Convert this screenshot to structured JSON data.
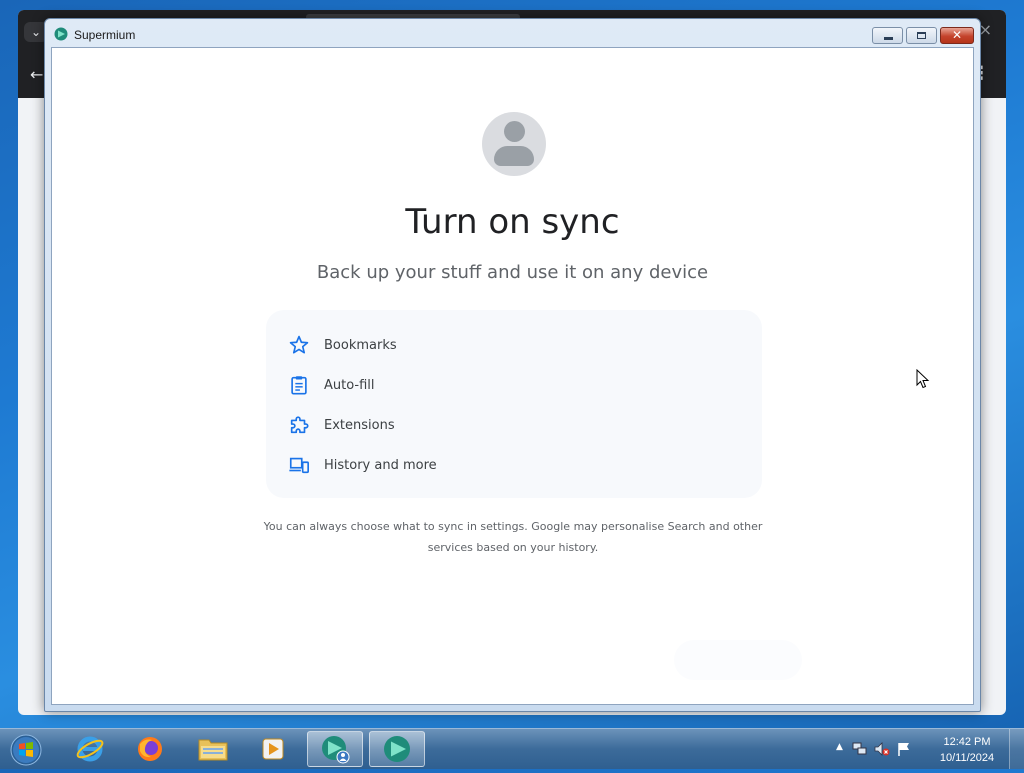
{
  "window": {
    "title": "Supermium",
    "controls": {
      "minimize": "minimize",
      "maximize": "maximize",
      "close": "close"
    }
  },
  "background_browser": {
    "close_glyph": "×",
    "back_glyph": "←",
    "menu_glyph": "⋮",
    "tab_chevron": "⌄"
  },
  "sync": {
    "heading": "Turn on sync",
    "subheading": "Back up your stuff and use it on any device",
    "features": [
      {
        "label": "Bookmarks",
        "icon": "star-icon"
      },
      {
        "label": "Auto-fill",
        "icon": "clipboard-icon"
      },
      {
        "label": "Extensions",
        "icon": "puzzle-icon"
      },
      {
        "label": "History and more",
        "icon": "devices-icon"
      }
    ],
    "footnote_line1": "You can always choose what to sync in settings. Google may personalise Search and other",
    "footnote_line2": "services based on your history."
  },
  "taskbar": {
    "items": [
      "start-orb",
      "internet-explorer",
      "firefox",
      "file-explorer",
      "media-player",
      "supermium-profile",
      "supermium"
    ],
    "tray": {
      "show_hidden": "▲",
      "time": "12:42 PM",
      "date": "10/11/2024"
    }
  },
  "colors": {
    "icon_blue": "#1a73e8",
    "heading": "#202124",
    "muted": "#5f6368"
  }
}
